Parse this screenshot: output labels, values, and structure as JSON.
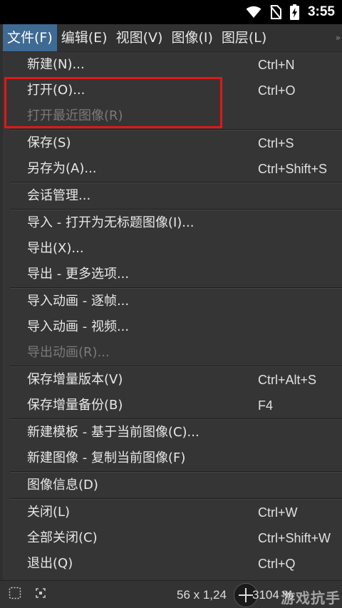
{
  "status_bar": {
    "time": "3:55"
  },
  "menubar": {
    "items": [
      {
        "label": "文件(F)",
        "active": true
      },
      {
        "label": "编辑(E)"
      },
      {
        "label": "视图(V)"
      },
      {
        "label": "图像(I)"
      },
      {
        "label": "图层(L)"
      }
    ],
    "overflow": "»"
  },
  "file_menu": {
    "groups": [
      [
        {
          "label": "新建(N)...",
          "shortcut": "Ctrl+N"
        },
        {
          "label": "打开(O)...",
          "shortcut": "Ctrl+O"
        },
        {
          "label": "打开最近图像(R)",
          "shortcut": "",
          "disabled": true
        }
      ],
      [
        {
          "label": "保存(S)",
          "shortcut": "Ctrl+S"
        },
        {
          "label": "另存为(A)...",
          "shortcut": "Ctrl+Shift+S"
        }
      ],
      [
        {
          "label": "会话管理...",
          "shortcut": ""
        }
      ],
      [
        {
          "label": "导入 - 打开为无标题图像(I)...",
          "shortcut": ""
        },
        {
          "label": "导出(X)...",
          "shortcut": ""
        },
        {
          "label": "导出 - 更多选项...",
          "shortcut": ""
        }
      ],
      [
        {
          "label": "导入动画 - 逐帧...",
          "shortcut": ""
        },
        {
          "label": "导入动画 - 视频...",
          "shortcut": ""
        },
        {
          "label": "导出动画(R)...",
          "shortcut": "",
          "disabled": true
        }
      ],
      [
        {
          "label": "保存增量版本(V)",
          "shortcut": "Ctrl+Alt+S"
        },
        {
          "label": "保存增量备份(B)",
          "shortcut": "F4"
        }
      ],
      [
        {
          "label": "新建模板 - 基于当前图像(C)...",
          "shortcut": ""
        },
        {
          "label": "新建图像 - 复制当前图像(F)",
          "shortcut": ""
        }
      ],
      [
        {
          "label": "图像信息(D)",
          "shortcut": ""
        }
      ],
      [
        {
          "label": "关闭(L)",
          "shortcut": "Ctrl+W"
        },
        {
          "label": "全部关闭(C)",
          "shortcut": "Ctrl+Shift+W"
        },
        {
          "label": "退出(Q)",
          "shortcut": "Ctrl+Q"
        }
      ]
    ]
  },
  "bottom_bar": {
    "coords": "56 x 1,24",
    "zoom": "3104 %"
  },
  "watermark": "游戏抗手",
  "colors": {
    "highlight_box": "#e01818",
    "active_menu": "#3e6a94"
  }
}
